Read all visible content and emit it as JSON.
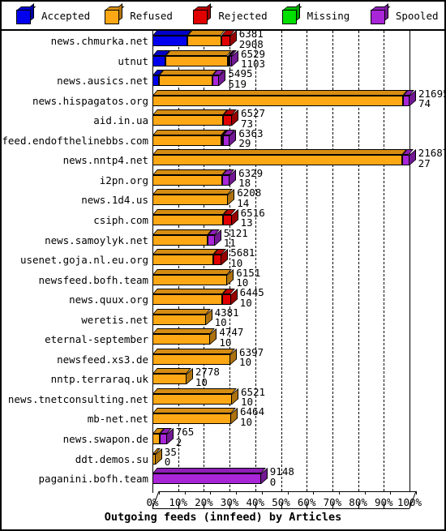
{
  "chart_data": {
    "type": "bar",
    "title": "Outgoing feeds (innfeed) by Articles",
    "xlabel": "Outgoing feeds (innfeed) by Articles",
    "ylabel": "",
    "orientation": "horizontal",
    "stacked": true,
    "grid": true,
    "legend_position": "top",
    "xlim": [
      0,
      100
    ],
    "xticks": [
      "0%",
      "10%",
      "20%",
      "30%",
      "40%",
      "50%",
      "60%",
      "70%",
      "80%",
      "90%",
      "100%"
    ],
    "xtick_values": [
      0,
      10,
      20,
      30,
      40,
      50,
      60,
      70,
      80,
      90,
      100
    ],
    "series": [
      {
        "name": "Accepted",
        "color": "#0000EE"
      },
      {
        "name": "Refused",
        "color": "#FFA816"
      },
      {
        "name": "Rejected",
        "color": "#E00000"
      },
      {
        "name": "Missing",
        "color": "#00E000"
      },
      {
        "name": "Spooled",
        "color": "#A825D8"
      }
    ],
    "categories": [
      "news.chmurka.net",
      "utnut",
      "news.ausics.net",
      "news.hispagatos.org",
      "aid.in.ua",
      "newsfeed.endofthelinebbs.com",
      "news.nntp4.net",
      "i2pn.org",
      "news.1d4.us",
      "csiph.com",
      "news.samoylyk.net",
      "usenet.goja.nl.eu.org",
      "newsfeed.bofh.team",
      "news.quux.org",
      "weretis.net",
      "eternal-september",
      "newsfeed.xs3.de",
      "nntp.terraraq.uk",
      "news.tnetconsulting.net",
      "mb-net.net",
      "news.swapon.de",
      "ddt.demos.su",
      "paganini.bofh.team"
    ],
    "rows": [
      {
        "label": "news.chmurka.net",
        "value_top": "6381",
        "value_bottom": "2908",
        "total_pct": 30.2,
        "segments": [
          {
            "series": "Accepted",
            "pct": 13.7
          },
          {
            "series": "Refused",
            "pct": 13.0
          },
          {
            "series": "Rejected",
            "pct": 3.5
          }
        ]
      },
      {
        "label": "utnut",
        "value_top": "6529",
        "value_bottom": "1103",
        "total_pct": 30.9,
        "segments": [
          {
            "series": "Accepted",
            "pct": 5.2
          },
          {
            "series": "Refused",
            "pct": 24.1
          },
          {
            "series": "Rejected",
            "pct": 0.7
          },
          {
            "series": "Spooled",
            "pct": 0.9
          }
        ]
      },
      {
        "label": "news.ausics.net",
        "value_top": "5495",
        "value_bottom": "519",
        "total_pct": 26.0,
        "segments": [
          {
            "series": "Accepted",
            "pct": 2.4
          },
          {
            "series": "Refused",
            "pct": 20.9
          },
          {
            "series": "Spooled",
            "pct": 2.7
          }
        ]
      },
      {
        "label": "news.hispagatos.org",
        "value_top": "21695",
        "value_bottom": "74",
        "total_pct": 100.0,
        "segments": [
          {
            "series": "Refused",
            "pct": 97.6
          },
          {
            "series": "Spooled",
            "pct": 2.4
          }
        ]
      },
      {
        "label": "aid.in.ua",
        "value_top": "6527",
        "value_bottom": "73",
        "total_pct": 30.9,
        "segments": [
          {
            "series": "Refused",
            "pct": 27.4
          },
          {
            "series": "Rejected",
            "pct": 3.5
          }
        ]
      },
      {
        "label": "newsfeed.endofthelinebbs.com",
        "value_top": "6363",
        "value_bottom": "29",
        "total_pct": 30.1,
        "segments": [
          {
            "series": "Refused",
            "pct": 26.8
          },
          {
            "series": "Rejected",
            "pct": 0.6
          },
          {
            "series": "Spooled",
            "pct": 2.7
          }
        ]
      },
      {
        "label": "news.nntp4.net",
        "value_top": "21687",
        "value_bottom": "27",
        "total_pct": 99.9,
        "segments": [
          {
            "series": "Refused",
            "pct": 97.3
          },
          {
            "series": "Spooled",
            "pct": 2.6
          }
        ]
      },
      {
        "label": "i2pn.org",
        "value_top": "6329",
        "value_bottom": "18",
        "total_pct": 30.0,
        "segments": [
          {
            "series": "Refused",
            "pct": 27.2
          },
          {
            "series": "Spooled",
            "pct": 2.8
          }
        ]
      },
      {
        "label": "news.1d4.us",
        "value_top": "6208",
        "value_bottom": "14",
        "total_pct": 29.4,
        "segments": [
          {
            "series": "Refused",
            "pct": 29.4
          }
        ]
      },
      {
        "label": "csiph.com",
        "value_top": "6516",
        "value_bottom": "13",
        "total_pct": 30.8,
        "segments": [
          {
            "series": "Refused",
            "pct": 27.5
          },
          {
            "series": "Rejected",
            "pct": 3.3
          }
        ]
      },
      {
        "label": "news.samoylyk.net",
        "value_top": "5121",
        "value_bottom": "11",
        "total_pct": 24.2,
        "segments": [
          {
            "series": "Refused",
            "pct": 21.5
          },
          {
            "series": "Spooled",
            "pct": 2.7
          }
        ]
      },
      {
        "label": "usenet.goja.nl.eu.org",
        "value_top": "5681",
        "value_bottom": "10",
        "total_pct": 26.9,
        "segments": [
          {
            "series": "Refused",
            "pct": 23.6
          },
          {
            "series": "Rejected",
            "pct": 3.3
          }
        ]
      },
      {
        "label": "newsfeed.bofh.team",
        "value_top": "6151",
        "value_bottom": "10",
        "total_pct": 29.1,
        "segments": [
          {
            "series": "Refused",
            "pct": 29.1
          }
        ]
      },
      {
        "label": "news.quux.org",
        "value_top": "6445",
        "value_bottom": "10",
        "total_pct": 30.5,
        "segments": [
          {
            "series": "Refused",
            "pct": 27.2
          },
          {
            "series": "Rejected",
            "pct": 3.3
          }
        ]
      },
      {
        "label": "weretis.net",
        "value_top": "4381",
        "value_bottom": "10",
        "total_pct": 20.7,
        "segments": [
          {
            "series": "Refused",
            "pct": 20.7
          }
        ]
      },
      {
        "label": "eternal-september",
        "value_top": "4747",
        "value_bottom": "10",
        "total_pct": 22.5,
        "segments": [
          {
            "series": "Refused",
            "pct": 22.5
          }
        ]
      },
      {
        "label": "newsfeed.xs3.de",
        "value_top": "6397",
        "value_bottom": "10",
        "total_pct": 30.3,
        "segments": [
          {
            "series": "Refused",
            "pct": 30.3
          }
        ]
      },
      {
        "label": "nntp.terraraq.uk",
        "value_top": "2778",
        "value_bottom": "10",
        "total_pct": 13.2,
        "segments": [
          {
            "series": "Refused",
            "pct": 13.2
          }
        ]
      },
      {
        "label": "news.tnetconsulting.net",
        "value_top": "6521",
        "value_bottom": "10",
        "total_pct": 30.9,
        "segments": [
          {
            "series": "Refused",
            "pct": 30.9
          }
        ]
      },
      {
        "label": "mb-net.net",
        "value_top": "6464",
        "value_bottom": "10",
        "total_pct": 30.6,
        "segments": [
          {
            "series": "Refused",
            "pct": 30.6
          }
        ]
      },
      {
        "label": "news.swapon.de",
        "value_top": "765",
        "value_bottom": "2",
        "total_pct": 5.6,
        "segments": [
          {
            "series": "Refused",
            "pct": 2.8
          },
          {
            "series": "Spooled",
            "pct": 2.8
          }
        ]
      },
      {
        "label": "ddt.demos.su",
        "value_top": "35",
        "value_bottom": "0",
        "total_pct": 1.2,
        "segments": [
          {
            "series": "Refused",
            "pct": 1.2
          }
        ]
      },
      {
        "label": "paganini.bofh.team",
        "value_top": "9148",
        "value_bottom": "0",
        "total_pct": 42.2,
        "segments": [
          {
            "series": "Spooled",
            "pct": 42.2
          }
        ]
      }
    ]
  },
  "legend": {
    "items": [
      {
        "label": "Accepted",
        "color": "#0000EE"
      },
      {
        "label": "Refused",
        "color": "#FFA816"
      },
      {
        "label": "Rejected",
        "color": "#E00000"
      },
      {
        "label": "Missing",
        "color": "#00E000"
      },
      {
        "label": "Spooled",
        "color": "#A825D8"
      }
    ]
  },
  "axis": {
    "title": "Outgoing feeds (innfeed) by Articles",
    "ticks": [
      "0%",
      "10%",
      "20%",
      "30%",
      "40%",
      "50%",
      "60%",
      "70%",
      "80%",
      "90%",
      "100%"
    ]
  }
}
